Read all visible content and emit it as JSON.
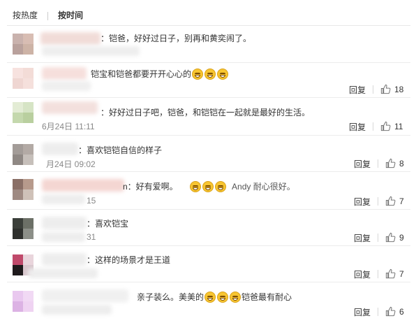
{
  "tabs": [
    {
      "label": "按热度",
      "active": false
    },
    {
      "label": "按时间",
      "active": true
    }
  ],
  "comments": [
    {
      "text": "：铠爸，好好过日子，别再和黄奕闹了。",
      "time": "",
      "reply": "",
      "likes": ""
    },
    {
      "text": "铠宝和铠爸都要开开心心的",
      "emoji_count": 3,
      "time": "",
      "reply": "回复",
      "likes": "18"
    },
    {
      "text": "：好好过日子吧，铠爸，和铠铠在一起就是最好的生活。",
      "time": "6月24日 11:11",
      "reply": "回复",
      "likes": "11"
    },
    {
      "text": "：喜欢铠铠自信的样子",
      "time": "月24日 09:02",
      "reply": "回复",
      "likes": "8"
    },
    {
      "text_a": "n：好有爱啊。",
      "text_b": "Andy 耐心很好。",
      "emoji_count": 3,
      "time": "15",
      "reply": "回复",
      "likes": "7"
    },
    {
      "text": "：喜欢铠宝",
      "time": "31",
      "reply": "回复",
      "likes": "9"
    },
    {
      "text": "：这样的场景才是王道",
      "time": "",
      "reply": "回复",
      "likes": "7"
    },
    {
      "text_a": "亲子装么。美美的",
      "text_b": "铠爸最有耐心",
      "emoji_count": 3,
      "time": "",
      "reply": "回复",
      "likes": "6"
    }
  ],
  "icons": {
    "like": "thumbs-up-icon",
    "emoji": "grin-emoji-icon"
  },
  "colors": {
    "text": "#333333",
    "time": "#888888",
    "divider": "#ececec",
    "emoji": "#f7c531"
  }
}
